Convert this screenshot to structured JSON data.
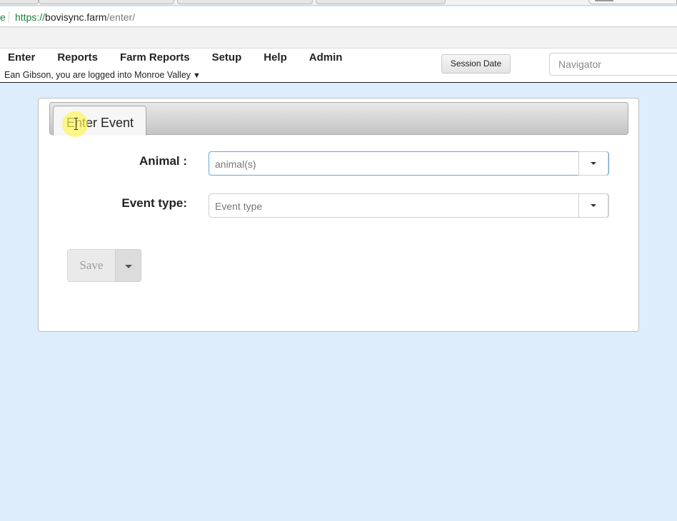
{
  "browser": {
    "url_fragment_left": "e",
    "url": {
      "scheme": "https://",
      "host": "bovisync.farm",
      "path": "/enter/"
    }
  },
  "menu": {
    "items": [
      {
        "label": "Enter"
      },
      {
        "label": "Reports"
      },
      {
        "label": "Farm Reports"
      },
      {
        "label": "Setup"
      },
      {
        "label": "Help"
      },
      {
        "label": "Admin"
      }
    ],
    "user_line": "Ean Gibson, you are logged into Monroe Valley",
    "user_caret": "▼",
    "session_date_label": "Session Date",
    "navigator_placeholder": "Navigator"
  },
  "panel": {
    "tab_label": "Enter Event",
    "animal": {
      "label": "Animal :",
      "placeholder": "animal(s)"
    },
    "event_type": {
      "label": "Event type:",
      "placeholder": "Event type"
    },
    "save_label": "Save"
  },
  "colors": {
    "page_background": "#deedfb",
    "focus_border": "#66a8e6",
    "secure_green": "#1a7f3c"
  }
}
